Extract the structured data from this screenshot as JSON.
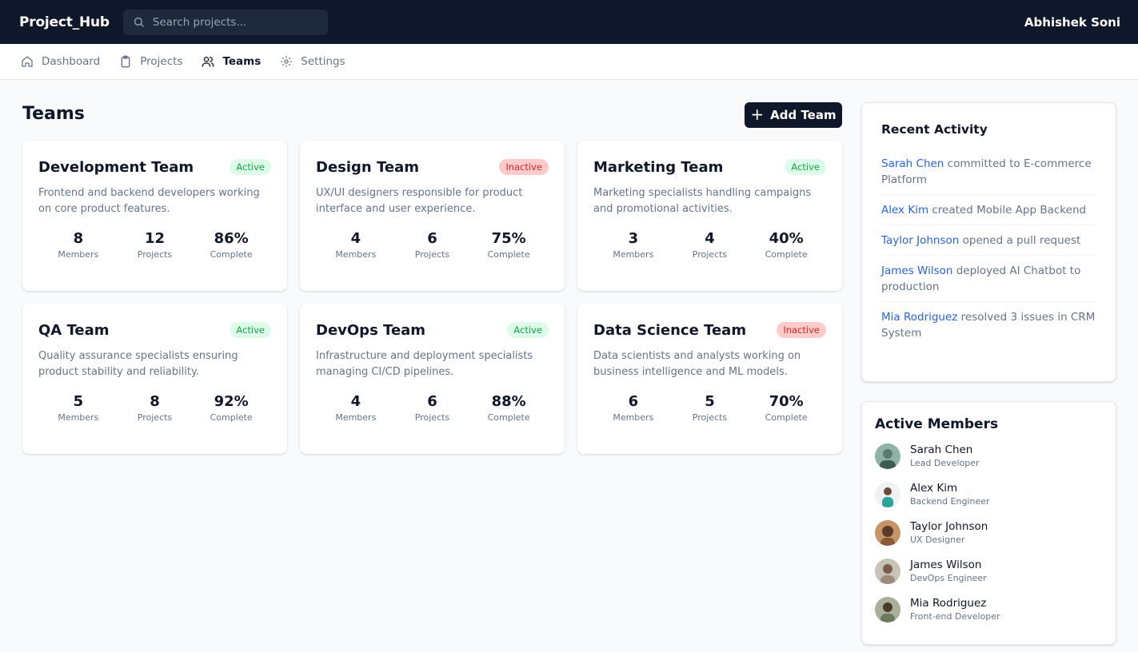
{
  "header": {
    "brand": "Project_Hub",
    "search_placeholder": "Search projects...",
    "user_name": "Abhishek Soni"
  },
  "nav": {
    "items": [
      {
        "label": "Dashboard",
        "icon": "home-icon"
      },
      {
        "label": "Projects",
        "icon": "clipboard-icon"
      },
      {
        "label": "Teams",
        "icon": "users-icon",
        "active": true
      },
      {
        "label": "Settings",
        "icon": "gear-icon"
      }
    ]
  },
  "page": {
    "title": "Teams",
    "add_button_label": "Add Team"
  },
  "teams": [
    {
      "name": "Development Team",
      "status": "Active",
      "description": "Frontend and backend developers working on core product features.",
      "members": "8",
      "projects": "12",
      "complete": "86%"
    },
    {
      "name": "Design Team",
      "status": "Inactive",
      "description": "UX/UI designers responsible for product interface and user experience.",
      "members": "4",
      "projects": "6",
      "complete": "75%"
    },
    {
      "name": "Marketing Team",
      "status": "Active",
      "description": "Marketing specialists handling campaigns and promotional activities.",
      "members": "3",
      "projects": "4",
      "complete": "40%"
    },
    {
      "name": "QA Team",
      "status": "Active",
      "description": "Quality assurance specialists ensuring product stability and reliability.",
      "members": "5",
      "projects": "8",
      "complete": "92%"
    },
    {
      "name": "DevOps Team",
      "status": "Active",
      "description": "Infrastructure and deployment specialists managing CI/CD pipelines.",
      "members": "4",
      "projects": "6",
      "complete": "88%"
    },
    {
      "name": "Data Science Team",
      "status": "Inactive",
      "description": "Data scientists and analysts working on business intelligence and ML models.",
      "members": "6",
      "projects": "5",
      "complete": "70%"
    }
  ],
  "stat_labels": {
    "members": "Members",
    "projects": "Projects",
    "complete": "Complete"
  },
  "recent_activity": {
    "title": "Recent Activity",
    "items": [
      {
        "user": "Sarah Chen",
        "action": " committed to E-commerce Platform"
      },
      {
        "user": "Alex Kim",
        "action": " created Mobile App Backend"
      },
      {
        "user": "Taylor Johnson",
        "action": " opened a pull request"
      },
      {
        "user": "James Wilson",
        "action": " deployed AI Chatbot to production"
      },
      {
        "user": "Mia Rodriguez",
        "action": " resolved 3 issues in CRM System"
      }
    ]
  },
  "active_members": {
    "title": "Active Members",
    "members": [
      {
        "name": "Sarah Chen",
        "role": "Lead Developer",
        "avatar_color": "#5b7a6e"
      },
      {
        "name": "Alex Kim",
        "role": "Backend Engineer",
        "avatar_color": "#2aa39a"
      },
      {
        "name": "Taylor Johnson",
        "role": "UX Designer",
        "avatar_color": "#8a5a3c"
      },
      {
        "name": "James Wilson",
        "role": "DevOps Engineer",
        "avatar_color": "#9a8a7a"
      },
      {
        "name": "Mia Rodriguez",
        "role": "Front-end Developer",
        "avatar_color": "#6b7a5a"
      }
    ]
  },
  "colors": {
    "header_bg": "#0f172a",
    "link_blue": "#2563eb",
    "active_green": "#16a34a",
    "inactive_red": "#dc2626"
  }
}
